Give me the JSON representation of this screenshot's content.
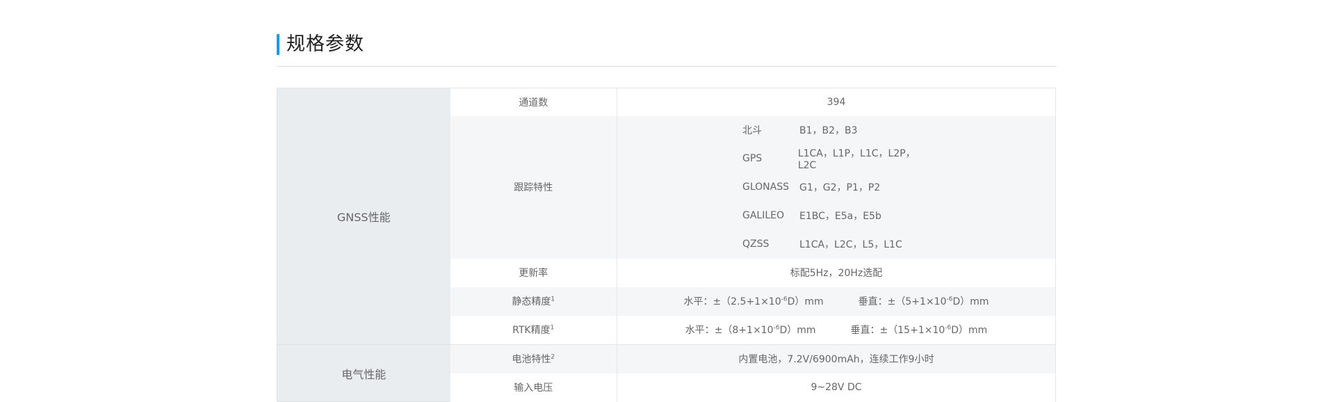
{
  "section": {
    "title": "规格参数"
  },
  "groups": {
    "gnss": "GNSS性能",
    "power": "电气性能"
  },
  "rows": {
    "channels": {
      "label": "通道数",
      "value": "394"
    },
    "tracking": {
      "label": "跟踪特性",
      "systems": [
        {
          "name": "北斗",
          "bands": "B1，B2，B3"
        },
        {
          "name": "GPS",
          "bands": "L1CA，L1P，L1C，L2P，L2C"
        },
        {
          "name": "GLONASS",
          "bands": "G1，G2，P1，P2"
        },
        {
          "name": "GALILEO",
          "bands": "E1BC，E5a，E5b"
        },
        {
          "name": "QZSS",
          "bands": "L1CA，L2C，L5，L1C"
        }
      ]
    },
    "update_rate": {
      "label": "更新率",
      "value": "标配5Hz，20Hz选配"
    },
    "static_accuracy": {
      "label": "静态精度",
      "sup": "1",
      "h_pre": "水平：±（2.5+1×10",
      "h_exp": "-6",
      "h_post": "D）mm",
      "v_pre": "垂直：±（5+1×10",
      "v_exp": "-6",
      "v_post": "D）mm"
    },
    "rtk_accuracy": {
      "label": "RTK精度",
      "sup": "1",
      "h_pre": "水平：±（8+1×10",
      "h_exp": "-6",
      "h_post": "D）mm",
      "v_pre": "垂直：±（15+1×10",
      "v_exp": "-6",
      "v_post": "D）mm"
    },
    "battery": {
      "label": "电池特性",
      "sup": "2",
      "value": "内置电池，7.2V/6900mAh，连续工作9小时"
    },
    "input_voltage": {
      "label": "输入电压",
      "value": "9~28V DC"
    }
  }
}
